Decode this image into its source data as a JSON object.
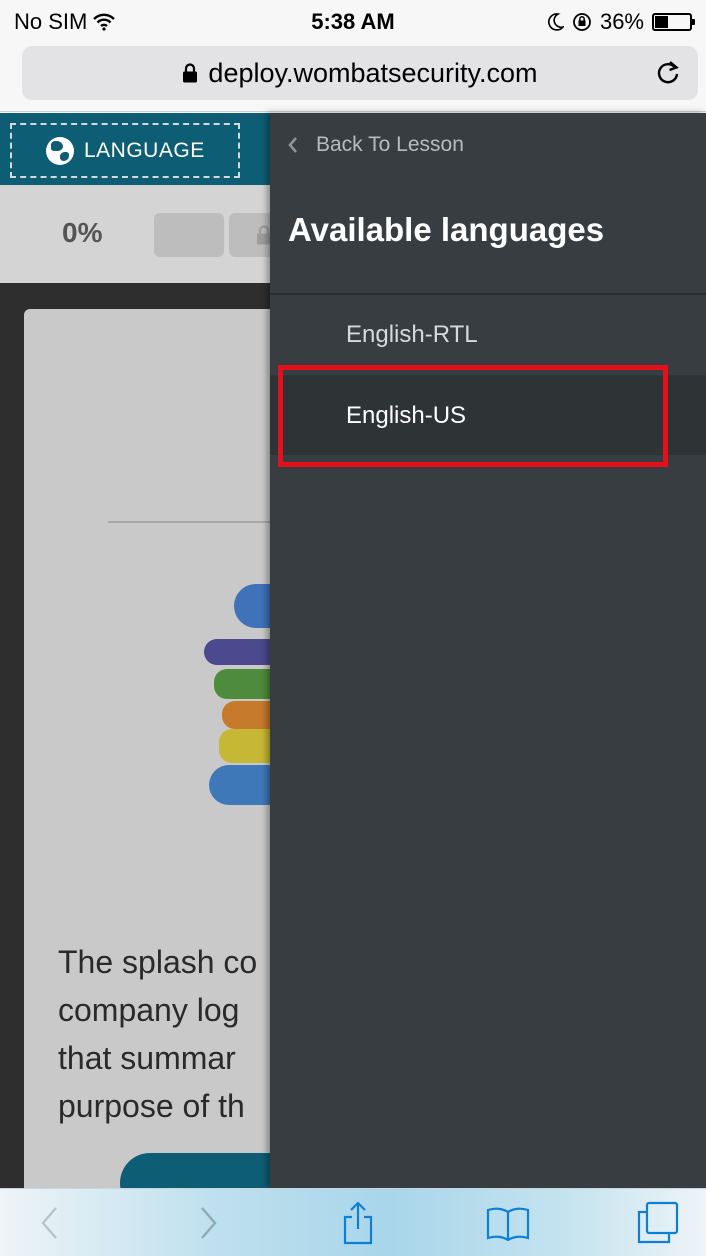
{
  "status_bar": {
    "carrier": "No SIM",
    "time": "5:38 AM",
    "battery_percent": "36%",
    "battery_level": 0.36
  },
  "browser": {
    "url": "deploy.wombatsecurity.com"
  },
  "lesson": {
    "language_button_label": "LANGUAGE",
    "progress_label": "0%",
    "body_text_lines": [
      "The splash co",
      "company log",
      "that summar",
      "purpose of th"
    ]
  },
  "drawer": {
    "back_label": "Back To Lesson",
    "title": "Available languages",
    "languages": [
      {
        "label": "English-RTL",
        "selected": false
      },
      {
        "label": "English-US",
        "selected": true
      }
    ]
  },
  "colors": {
    "drawer_bg": "#373d40",
    "header_teal": "#0d5d74",
    "highlight_red": "#e4101c"
  },
  "toolbar": {
    "icons": [
      "back-icon",
      "forward-icon",
      "share-icon",
      "bookmarks-icon",
      "tabs-icon"
    ]
  }
}
